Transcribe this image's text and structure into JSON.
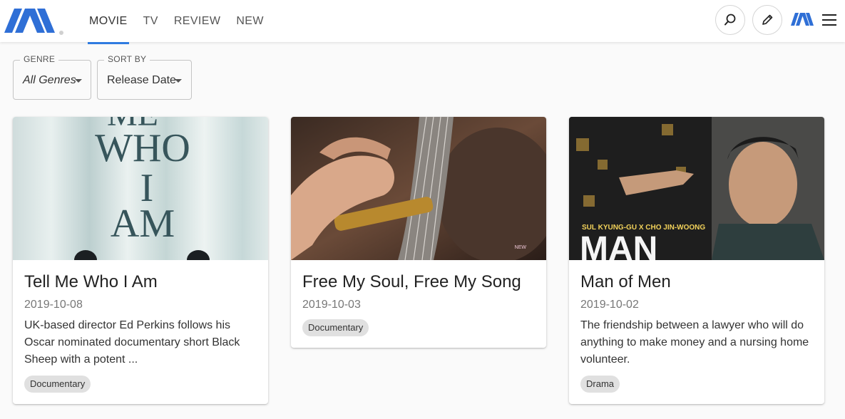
{
  "nav": {
    "tabs": [
      {
        "label": "MOVIE",
        "active": true
      },
      {
        "label": "TV",
        "active": false
      },
      {
        "label": "REVIEW",
        "active": false
      },
      {
        "label": "NEW",
        "active": false
      }
    ]
  },
  "header": {
    "icons": [
      "search-icon",
      "pencil-icon",
      "brand-logo-icon",
      "hamburger-menu-icon"
    ]
  },
  "filters": {
    "genre": {
      "label": "GENRE",
      "value": "All Genres"
    },
    "sort": {
      "label": "SORT BY",
      "value": "Release Date"
    }
  },
  "poster_text": {
    "tell_me": [
      "ME",
      "WHO",
      "I",
      "AM"
    ],
    "free_soul": "NEW",
    "man_of_men_names": "SUL KYUNG-GU X CHO JIN-WOONG",
    "man_of_men_title": "MAN"
  },
  "cards": [
    {
      "title": "Tell Me Who I Am",
      "date": "2019-10-08",
      "description": "UK-based director Ed Perkins follows his Oscar nominated documentary short Black Sheep with a potent ...",
      "genre": "Documentary"
    },
    {
      "title": "Free My Soul, Free My Song",
      "date": "2019-10-03",
      "description": "",
      "genre": "Documentary"
    },
    {
      "title": "Man of Men",
      "date": "2019-10-02",
      "description": "The friendship between a lawyer who will do anything to make money and a nursing home volunteer.",
      "genre": "Drama"
    }
  ],
  "colors": {
    "accent": "#2f7be0",
    "brand": "#2f6fd6",
    "chip_bg": "#e0e0e0"
  }
}
